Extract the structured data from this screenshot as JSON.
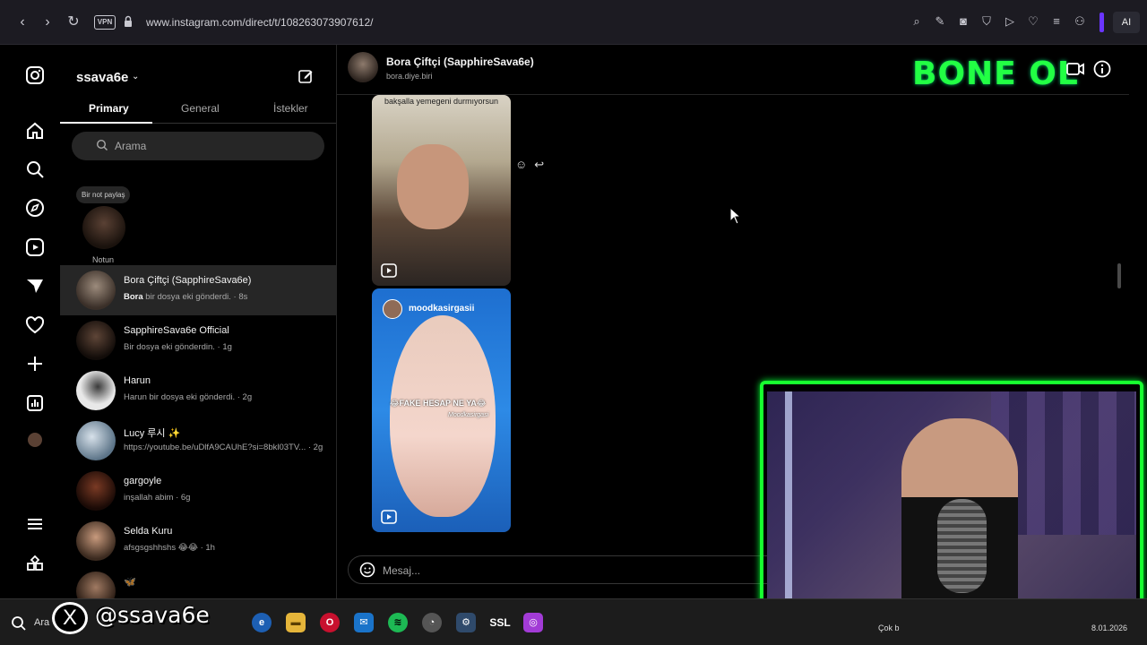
{
  "browser": {
    "url": "www.instagram.com/direct/t/108263073907612/",
    "vpn_label": "VPN",
    "ai_label": "AI"
  },
  "dm_list": {
    "username": "ssava6e",
    "tabs": [
      {
        "label": "Primary"
      },
      {
        "label": "General"
      },
      {
        "label": "İstekler"
      }
    ],
    "search_placeholder": "Arama",
    "note": {
      "bubble": "Bir not paylaş",
      "label": "Notun"
    },
    "chats": [
      {
        "name": "Bora Çiftçi (SapphireSava6e)",
        "sender": "Bora",
        "preview": " bir dosya eki gönderdi. · 8s",
        "color": "#6f6258"
      },
      {
        "name": "SapphireSava6e Official",
        "sender": "",
        "preview": "Bir dosya eki gönderdin. · 1g",
        "color": "#3e2b22"
      },
      {
        "name": "Harun",
        "sender": "",
        "preview": "Harun bir dosya eki gönderdi. · 2g",
        "color": "#d8d8d8"
      },
      {
        "name": "Lucy 루시 ✨",
        "sender": "",
        "preview": "https://youtube.be/uDlfA9CAUhE?si=8bkl03TV... · 2g",
        "color": "#8fa6b8"
      },
      {
        "name": "gargoyle",
        "sender": "",
        "preview": "inşallah abim · 6g",
        "color": "#5a2a1f"
      },
      {
        "name": "Selda Kuru",
        "sender": "",
        "preview": "afsgsgshhshs 😂😂 · 1h",
        "color": "#7c5c45"
      },
      {
        "name": "🦋",
        "sender": "",
        "preview": "",
        "color": "#6b4a3b"
      }
    ]
  },
  "chat": {
    "name": "Bora Çiftçi (SapphireSava6e)",
    "subtitle": "bora.diye.biri",
    "reel1_caption": "bakşalla yemegeni durmıyorsun",
    "reel2_account": "moodkasirgasii",
    "reel2_overlay": "😂FAKE HESAP NE YA😂",
    "reel2_watermark": "Moodkasirgasi",
    "message_placeholder": "Mesaj..."
  },
  "overlay": {
    "banner_text": "BONE OL",
    "x_logo": "X",
    "handle": "@ssava6e"
  },
  "taskbar": {
    "search_label": "Ara",
    "weather_label": "Çok b",
    "date": "8.01.2026",
    "ssl_label": "SSL"
  },
  "colors": {
    "accent_green": "#17ff2f",
    "instagram_bg": "#000000",
    "selected_row": "#262626"
  }
}
